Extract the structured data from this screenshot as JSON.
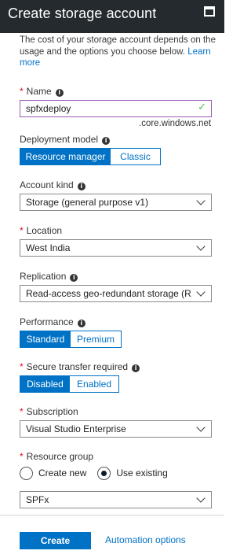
{
  "header": {
    "title": "Create storage account",
    "maximize_icon": "maximize-icon"
  },
  "description": {
    "text": "The cost of your storage account depends on the usage and the options you choose below.",
    "learn_more": "Learn more"
  },
  "name": {
    "label": "Name",
    "value": "spfxdeploy",
    "suffix": ".core.windows.net"
  },
  "deployment_model": {
    "label": "Deployment model",
    "options": [
      "Resource manager",
      "Classic"
    ],
    "selected": "Resource manager"
  },
  "account_kind": {
    "label": "Account kind",
    "value": "Storage (general purpose v1)"
  },
  "location": {
    "label": "Location",
    "value": "West India"
  },
  "replication": {
    "label": "Replication",
    "value": "Read-access geo-redundant storage (R..."
  },
  "performance": {
    "label": "Performance",
    "options": [
      "Standard",
      "Premium"
    ],
    "selected": "Standard"
  },
  "secure_transfer": {
    "label": "Secure transfer required",
    "options": [
      "Disabled",
      "Enabled"
    ],
    "selected": "Disabled"
  },
  "subscription": {
    "label": "Subscription",
    "value": "Visual Studio Enterprise"
  },
  "resource_group": {
    "label": "Resource group",
    "radio_options": [
      "Create new",
      "Use existing"
    ],
    "selected": "Use existing",
    "value": "SPFx"
  },
  "footer": {
    "create": "Create",
    "automation": "Automation options"
  },
  "colors": {
    "header_bg": "#252a2e",
    "accent": "#0072c6",
    "required": "#e00b1c",
    "valid": "#5cb85c"
  }
}
